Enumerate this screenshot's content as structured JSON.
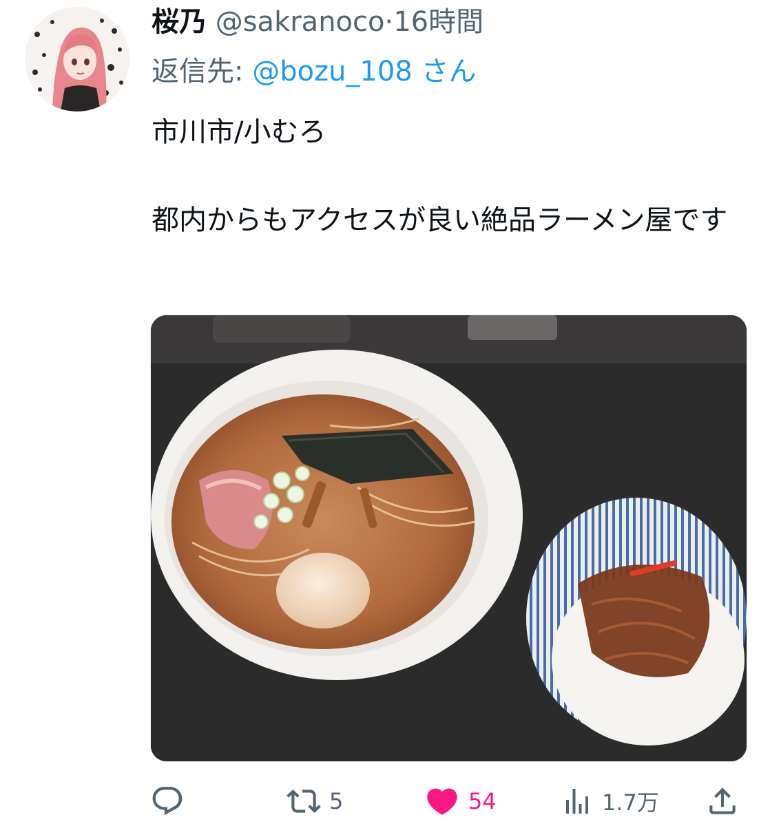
{
  "tweet": {
    "display_name": "桜乃",
    "handle": "@sakranoco",
    "separator": "·",
    "time": "16時間",
    "reply_prefix": "返信先:",
    "reply_mention": "@bozu_108",
    "reply_suffix": "さん",
    "text_line1": "市川市/小むろ",
    "text_line2": "都内からもアクセスが良い絶品ラーメン屋です"
  },
  "actions": {
    "reply_icon": "reply-icon",
    "retweet_icon": "retweet-icon",
    "retweet_count": "5",
    "like_icon": "heart-filled-icon",
    "like_count": "54",
    "views_icon": "views-bar-chart-icon",
    "views_count": "1.7万",
    "share_icon": "share-icon"
  },
  "colors": {
    "text": "#0f1419",
    "secondary": "#536471",
    "mention": "#1d9bf0",
    "like": "#f91880"
  }
}
